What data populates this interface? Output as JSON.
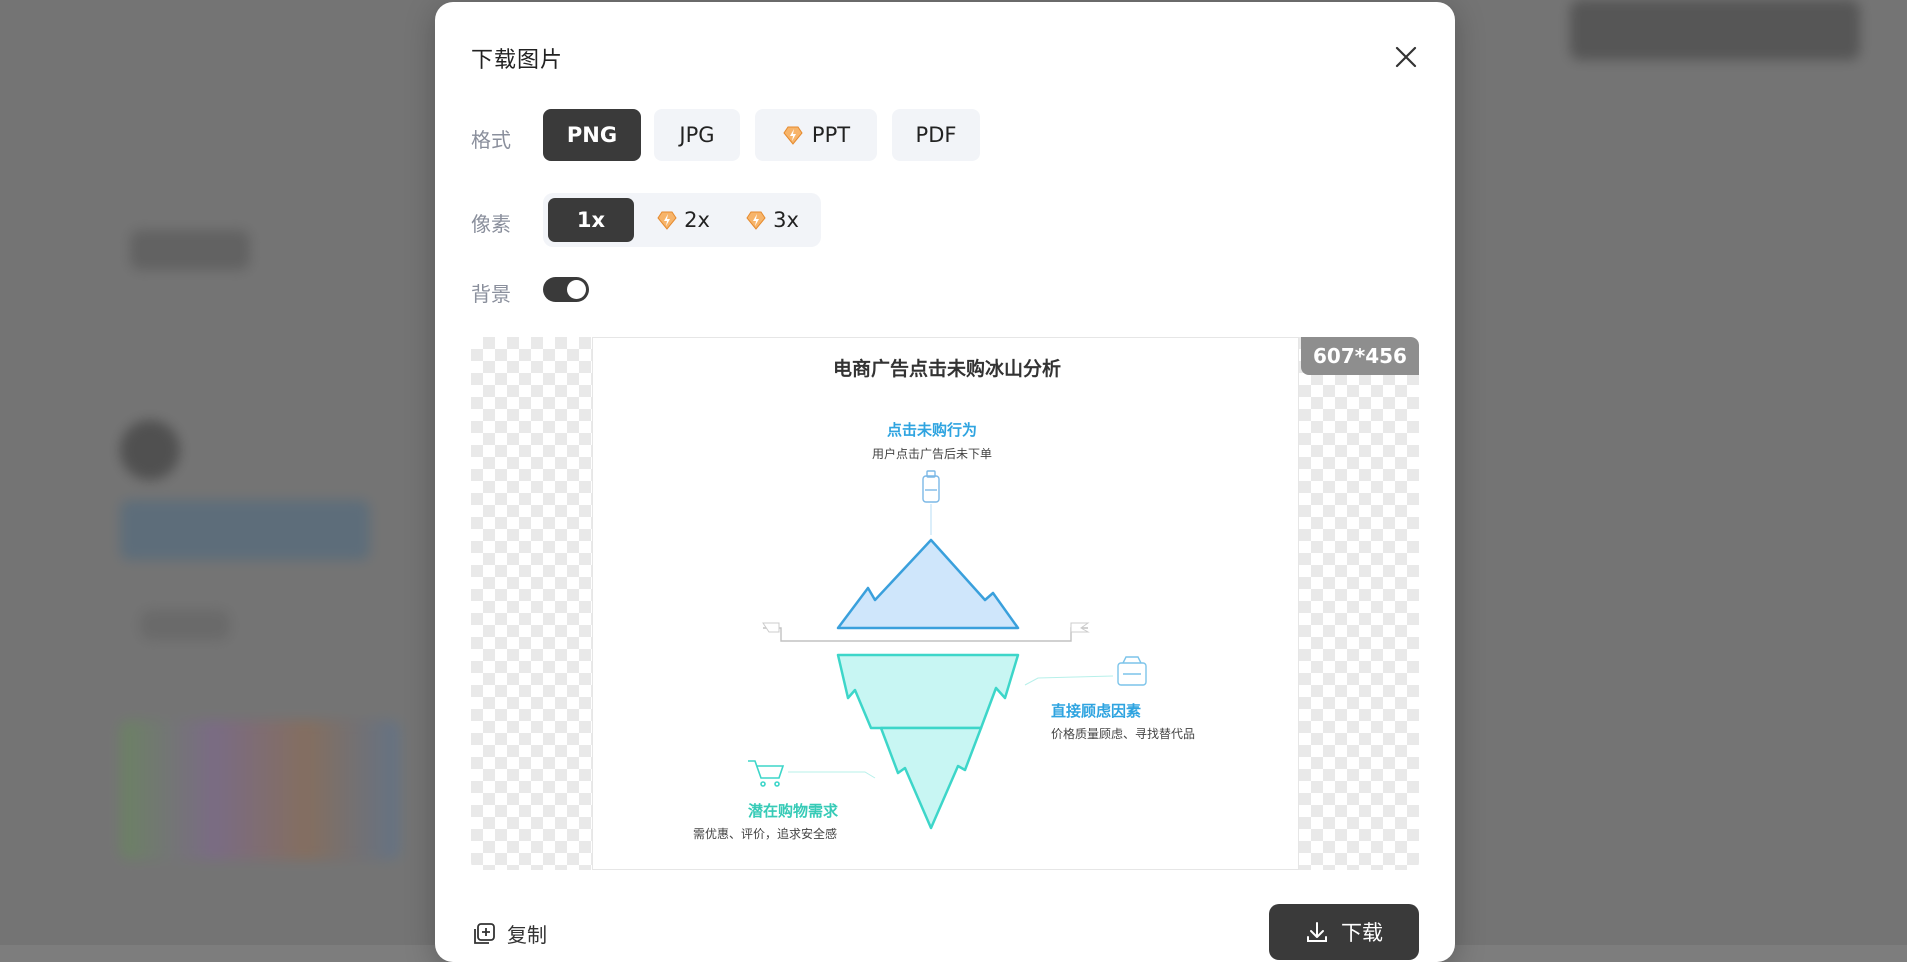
{
  "dialog": {
    "title": "下载图片"
  },
  "format": {
    "label": "格式",
    "options": [
      "PNG",
      "JPG",
      "PPT",
      "PDF"
    ],
    "selected": "PNG"
  },
  "scale": {
    "label": "像素",
    "options": [
      "1x",
      "2x",
      "3x"
    ],
    "selected": "1x"
  },
  "background": {
    "label": "背景",
    "enabled": true
  },
  "preview": {
    "dimensions": "607*456",
    "graphic": {
      "title": "电商广告点击未购冰山分析",
      "top_heading": "点击未购行为",
      "top_desc": "用户点击广告后未下单",
      "right_heading": "直接顾虑因素",
      "right_desc": "价格质量顾虑、寻找替代品",
      "left_heading": "潜在购物需求",
      "left_desc": "需优惠、评价，追求安全感"
    }
  },
  "actions": {
    "copy_label": "复制",
    "download_label": "下载"
  },
  "colors": {
    "dark": "#3a3a3a",
    "premium": "#f2a24a",
    "ice_top": "#cfe6fb",
    "ice_bottom": "#c8f6f3",
    "ice_stroke_top": "#3aa0dc",
    "ice_stroke_bottom": "#3dd6c9"
  },
  "icons": {
    "close": "close-icon",
    "premium": "premium-badge-icon",
    "copy": "copy-icon",
    "download": "download-icon"
  }
}
